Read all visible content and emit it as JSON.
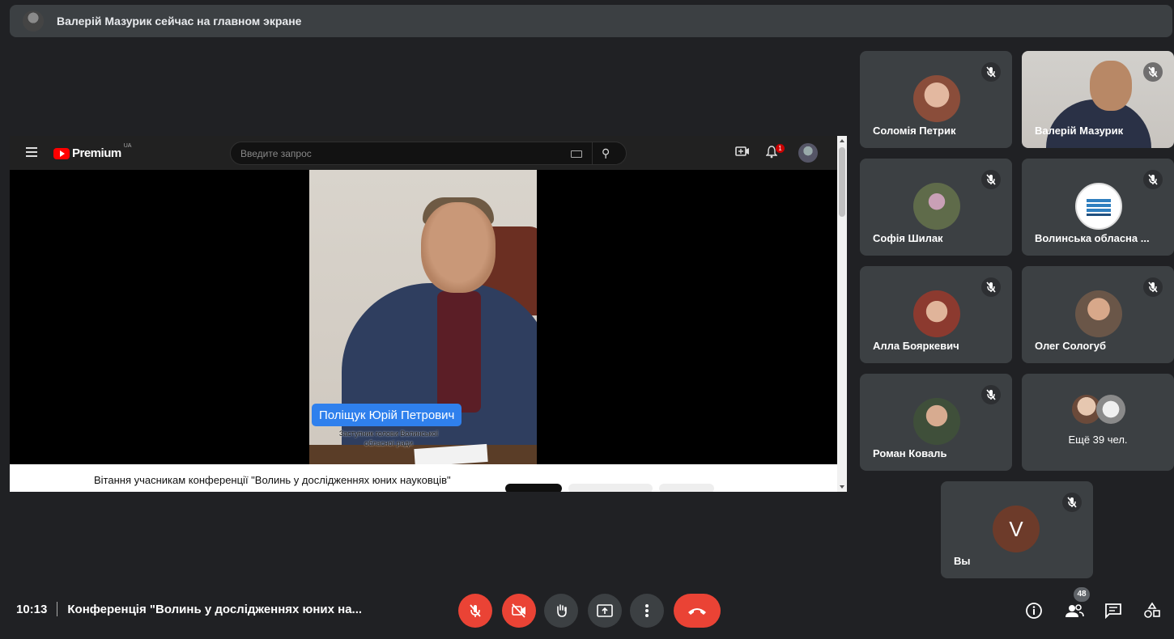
{
  "banner": {
    "text": "Валерій Мазурик сейчас на главном экране"
  },
  "presentation": {
    "youtube": {
      "logo_text": "Premium",
      "country_code": "UA",
      "search_placeholder": "Введите запрос",
      "notifications_count": "1"
    },
    "video": {
      "name_tag": "Поліщук Юрій Петрович",
      "subtitle": "Заступник голови Волинської обласної ради",
      "title": "Вітання учасникам конференції \"Волинь у дослідженнях юних науковців\""
    }
  },
  "participants": [
    {
      "name": "Соломія Петрик",
      "muted": true,
      "avatar_color": "#a0624c"
    },
    {
      "name": "Валерій Мазурик",
      "muted": true,
      "video": true
    },
    {
      "name": "Софія Шилак",
      "muted": true,
      "avatar_color": "#5f6b4a"
    },
    {
      "name": "Волинська обласна ...",
      "muted": true,
      "avatar_color": "#ffffff"
    },
    {
      "name": "Алла Бояркевич",
      "muted": true,
      "avatar_color": "#8c3a2f"
    },
    {
      "name": "Олег Сологуб",
      "muted": true,
      "avatar_color": "#6a5648"
    },
    {
      "name": "Роман Коваль",
      "muted": true,
      "avatar_color": "#3f4f3a"
    }
  ],
  "more_participants": {
    "label": "Ещё 39 чел."
  },
  "self_tile": {
    "name": "Вы",
    "initial": "V",
    "muted": true
  },
  "bottom_bar": {
    "time": "10:13",
    "meeting_title": "Конференція \"Волинь у дослідженнях юних на...",
    "participants_count": "48"
  },
  "colors": {
    "background": "#202124",
    "tile": "#3c4043",
    "danger": "#ea4335",
    "name_tag": "#2f80ed"
  }
}
